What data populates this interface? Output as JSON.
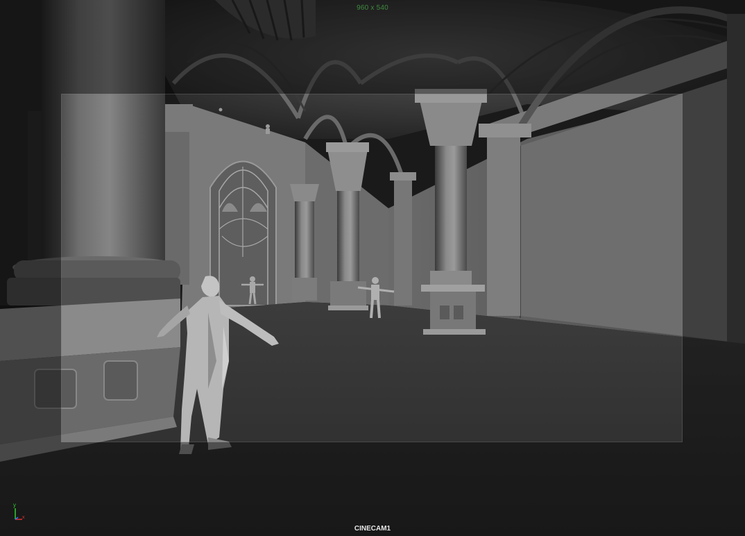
{
  "viewport": {
    "resolution_readout": "960 x 540",
    "camera_name": "CINECAM1"
  },
  "axis_gizmo": {
    "y_label": "y",
    "x_label": "x",
    "y_color": "#2fd02f",
    "x_color": "#e03030",
    "z_color": "#3a6cff"
  },
  "colors": {
    "readout_text": "#3f8a3f",
    "camera_text": "#e6e6e6"
  }
}
